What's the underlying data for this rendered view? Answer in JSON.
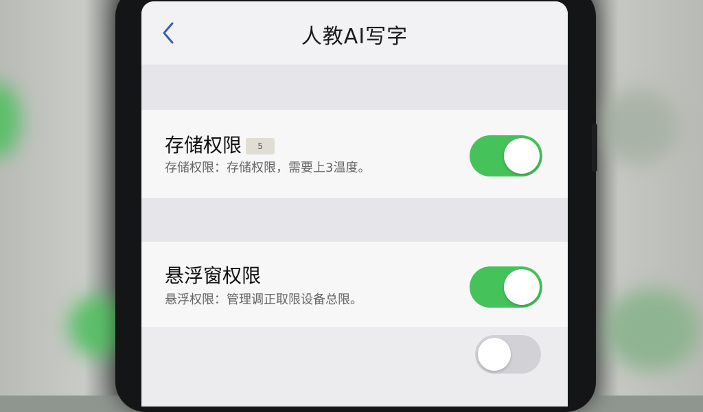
{
  "header": {
    "title": "人教AI写字",
    "back_icon": "chevron-left-icon"
  },
  "settings": [
    {
      "title": "存储权限",
      "badge": "5",
      "subtitle": "存储权限：存储权限，需要上3温度。",
      "enabled": true
    },
    {
      "title": "悬浮窗权限",
      "subtitle": "悬浮权限：管理调正取限设备总限。",
      "enabled": true
    },
    {
      "enabled": false
    }
  ],
  "colors": {
    "accent": "#46c25a",
    "toggle_off": "#d2d2d6",
    "back_icon": "#3a5fa8"
  }
}
